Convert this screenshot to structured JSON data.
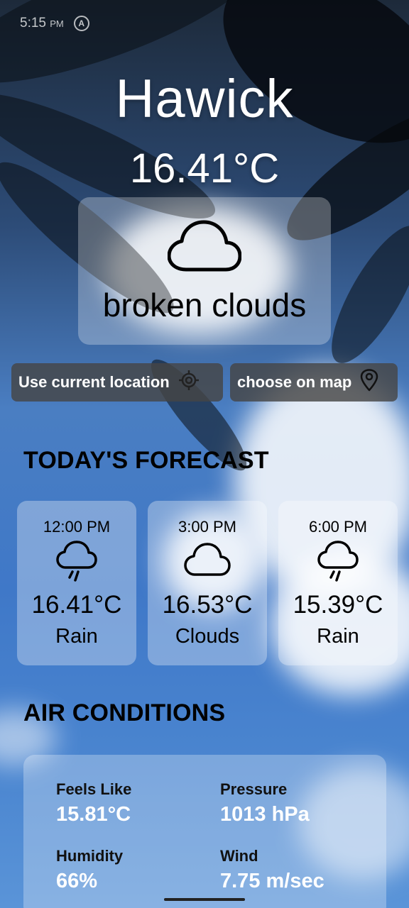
{
  "status_bar": {
    "time": "5:15",
    "ampm": "PM",
    "badge": "A"
  },
  "weather": {
    "city": "Hawick",
    "temperature": "16.41°C",
    "description": "broken clouds",
    "icon": "cloud-icon"
  },
  "location_buttons": {
    "current_label": "Use current location",
    "current_icon": "crosshair-icon",
    "map_label": "choose on map",
    "map_icon": "map-pin-icon"
  },
  "forecast": {
    "title": "TODAY'S FORECAST",
    "items": [
      {
        "time": "12:00 PM",
        "icon": "rain-cloud-icon",
        "temp": "16.41°C",
        "condition": "Rain"
      },
      {
        "time": "3:00 PM",
        "icon": "cloud-icon",
        "temp": "16.53°C",
        "condition": "Clouds"
      },
      {
        "time": "6:00 PM",
        "icon": "rain-cloud-icon",
        "temp": "15.39°C",
        "condition": "Rain"
      }
    ]
  },
  "air_conditions": {
    "title": "AIR CONDITIONS",
    "feels_like": {
      "label": "Feels Like",
      "value": "15.81°C"
    },
    "pressure": {
      "label": "Pressure",
      "value": "1013 hPa"
    },
    "humidity": {
      "label": "Humidity",
      "value": "66%"
    },
    "wind": {
      "label": "Wind",
      "value": "7.75 m/sec"
    }
  }
}
